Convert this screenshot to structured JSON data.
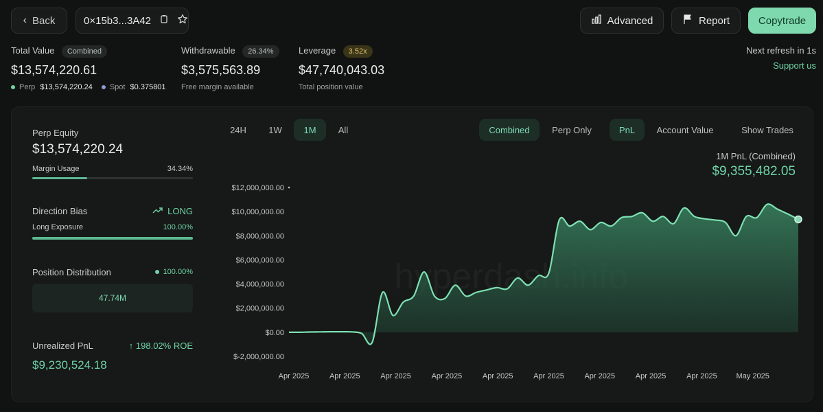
{
  "header": {
    "back_label": "Back",
    "address": "0×15b3...3A42",
    "advanced_label": "Advanced",
    "report_label": "Report",
    "copytrade_label": "Copytrade"
  },
  "summary": {
    "total_value": {
      "label": "Total Value",
      "badge": "Combined",
      "value": "$13,574,220.61",
      "perp_label": "Perp",
      "perp_value": "$13,574,220.24",
      "spot_label": "Spot",
      "spot_value": "$0.375801"
    },
    "withdrawable": {
      "label": "Withdrawable",
      "badge": "26.34%",
      "value": "$3,575,563.89",
      "sub": "Free margin available"
    },
    "leverage": {
      "label": "Leverage",
      "badge": "3.52x",
      "value": "$47,740,043.03",
      "sub": "Total position value"
    },
    "refresh": "Next refresh in 1s",
    "support": "Support us"
  },
  "left": {
    "perp_equity_label": "Perp Equity",
    "perp_equity_value": "$13,574,220.24",
    "margin_usage_label": "Margin Usage",
    "margin_usage_value": "34.34%",
    "margin_usage_fraction": 0.3434,
    "direction_label": "Direction Bias",
    "direction_value": "LONG",
    "long_exposure_label": "Long Exposure",
    "long_exposure_value": "100.00%",
    "long_exposure_fraction": 1.0,
    "position_dist_label": "Position Distribution",
    "position_dist_value": "100.00%",
    "position_dist_bar": "47.74M",
    "unrealized_label": "Unrealized PnL",
    "roe_value": "198.02% ROE",
    "unrealized_value": "$9,230,524.18"
  },
  "tabs": {
    "time": [
      "24H",
      "1W",
      "1M",
      "All"
    ],
    "mode": [
      "Combined",
      "Perp Only"
    ],
    "metric": [
      "PnL",
      "Account Value"
    ],
    "show_trades": "Show Trades"
  },
  "chart_title": "1M PnL (Combined)",
  "chart_value": "$9,355,482.05",
  "watermark": "hyperdash.info",
  "colors": {
    "accent": "#6fd3a6",
    "background": "#111312",
    "panel": "#161918",
    "line": "#7ee0b2"
  },
  "chart_data": {
    "type": "area",
    "title": "1M PnL (Combined)",
    "ylim": [
      -2000000,
      12000000
    ],
    "yticks": [
      "$12,000,000.00",
      "$10,000,000.00",
      "$8,000,000.00",
      "$6,000,000.00",
      "$4,000,000.00",
      "$2,000,000.00",
      "$0.00",
      "$-2,000,000.00"
    ],
    "xticks": [
      "Apr 2025",
      "Apr 2025",
      "Apr 2025",
      "Apr 2025",
      "Apr 2025",
      "Apr 2025",
      "Apr 2025",
      "Apr 2025",
      "Apr 2025",
      "May 2025"
    ],
    "series": [
      {
        "values": [
          0,
          0,
          20000,
          30000,
          40000,
          40000,
          30000,
          -100000,
          -850000,
          3300000,
          1400000,
          2500000,
          3000000,
          5000000,
          3000000,
          2800000,
          3900000,
          3000000,
          3300000,
          3500000,
          3700000,
          3600000,
          4500000,
          3900000,
          4700000,
          4900000,
          9300000,
          8800000,
          9200000,
          8500000,
          9100000,
          8800000,
          9500000,
          9600000,
          9900000,
          9200000,
          9600000,
          9000000,
          10300000,
          9600000,
          9400000,
          9300000,
          9100000,
          8000000,
          9600000,
          9500000,
          10600000,
          10200000,
          9800000,
          9355482
        ]
      }
    ]
  }
}
